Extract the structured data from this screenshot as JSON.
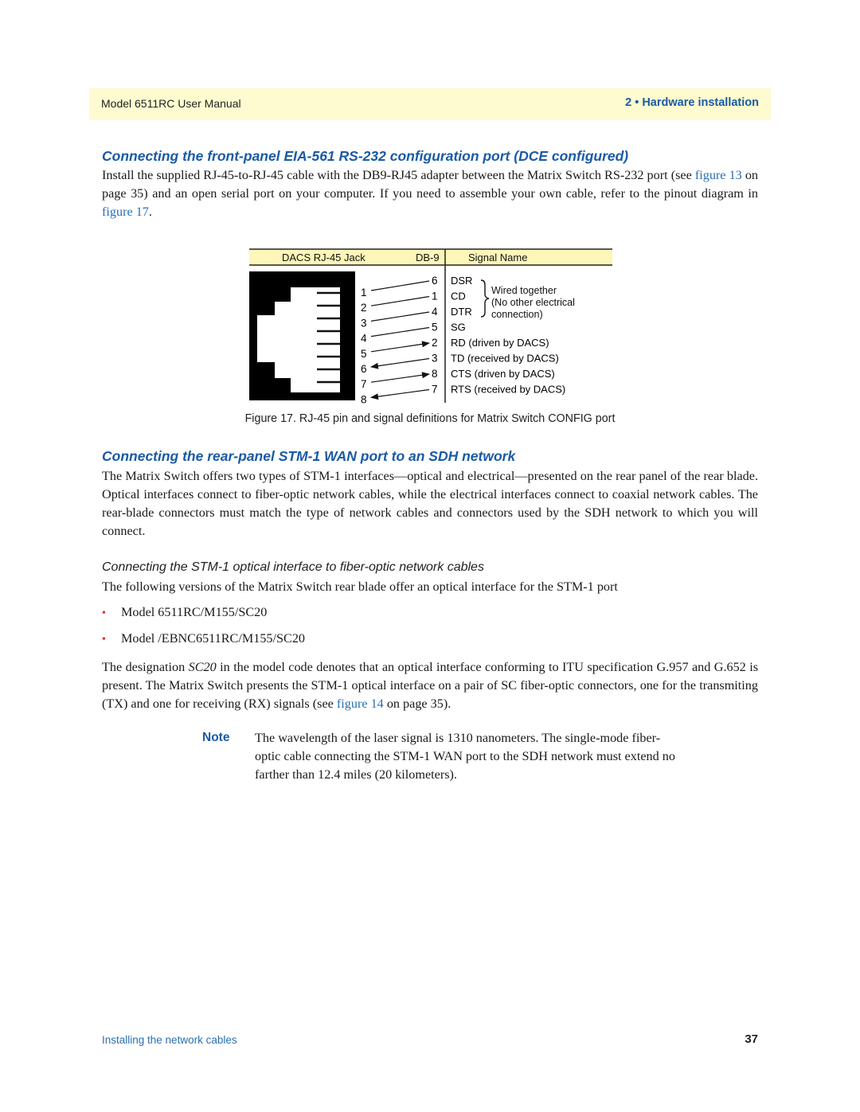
{
  "running_header": {
    "manual_title": "Model 6511RC User Manual",
    "chapter": "2 • Hardware installation"
  },
  "section1": {
    "heading": "Connecting the front-panel EIA-561 RS-232 configuration port (DCE configured)",
    "para_parts": [
      "Install the supplied RJ-45-to-RJ-45 cable with the DB9-RJ45 adapter between the Matrix Switch RS-232 port (see ",
      "figure 13",
      " on page 35) and an open serial port on your computer. If you need to assemble your own cable, refer to the pinout diagram in ",
      "figure 17",
      "."
    ]
  },
  "figure17": {
    "header": {
      "jack_label": "DACS RJ-45 Jack",
      "db9_label": "DB-9",
      "signal_label": "Signal Name"
    },
    "rj45_pins": [
      "1",
      "2",
      "3",
      "4",
      "5",
      "6",
      "7",
      "8"
    ],
    "db9_pins": [
      "6",
      "1",
      "4",
      "5",
      "2",
      "3",
      "8",
      "7"
    ],
    "signals": [
      "DSR",
      "CD",
      "DTR",
      "SG",
      "RD (driven by DACS)",
      "TD (received by DACS)",
      "CTS (driven by DACS)",
      "RTS (received by DACS)"
    ],
    "brace_note": [
      "Wired together",
      "(No other electrical",
      "connection)"
    ],
    "connections": [
      {
        "rj45": "1",
        "db9": "6",
        "direction": "none"
      },
      {
        "rj45": "2",
        "db9": "1",
        "direction": "none"
      },
      {
        "rj45": "3",
        "db9": "4",
        "direction": "none"
      },
      {
        "rj45": "4",
        "db9": "5",
        "direction": "none"
      },
      {
        "rj45": "5",
        "db9": "2",
        "direction": "to-db9"
      },
      {
        "rj45": "6",
        "db9": "3",
        "direction": "to-rj45"
      },
      {
        "rj45": "7",
        "db9": "8",
        "direction": "to-db9"
      },
      {
        "rj45": "8",
        "db9": "7",
        "direction": "to-rj45"
      }
    ],
    "caption": "Figure 17. RJ-45 pin and signal definitions for Matrix Switch CONFIG port"
  },
  "section2": {
    "heading": "Connecting the rear-panel STM-1 WAN port to an SDH network",
    "para": "The Matrix Switch offers two types of STM-1 interfaces—optical and electrical—presented on the rear panel of the rear blade. Optical interfaces connect to fiber-optic network cables, while the electrical interfaces connect to coaxial network cables. The rear-blade connectors must match the type of network cables and connectors used by the SDH network to which you will connect."
  },
  "section3": {
    "heading": "Connecting the STM-1 optical interface to fiber-optic network cables",
    "intro": "The following versions of the Matrix Switch rear blade offer an optical interface for the STM-1 port",
    "bullets": [
      "Model 6511RC/M155/SC20",
      "Model /EBNC6511RC/M155/SC20"
    ],
    "para_parts": [
      "The designation ",
      "SC20",
      " in the model code denotes that an optical interface conforming to ITU specification G.957 and G.652 is present. The Matrix Switch presents the STM-1 optical interface on a pair of SC fiber-optic connectors, one for the transmiting (TX) and one for receiving (RX) signals (see ",
      "figure 14",
      " on page 35)."
    ]
  },
  "note": {
    "label": "Note",
    "text": "The wavelength of the laser signal is 1310 nanometers. The single-mode fiber-optic cable connecting the STM-1 WAN port to the SDH network must extend no farther than 12.4 miles (20 kilometers)."
  },
  "footer": {
    "section_title": "Installing the network cables",
    "page_number": "37"
  },
  "colors": {
    "header_band": "#fdfbcf",
    "heading_blue": "#1a5aa6",
    "link_blue": "#2a6fb0",
    "bullet_red": "#e0202a"
  }
}
